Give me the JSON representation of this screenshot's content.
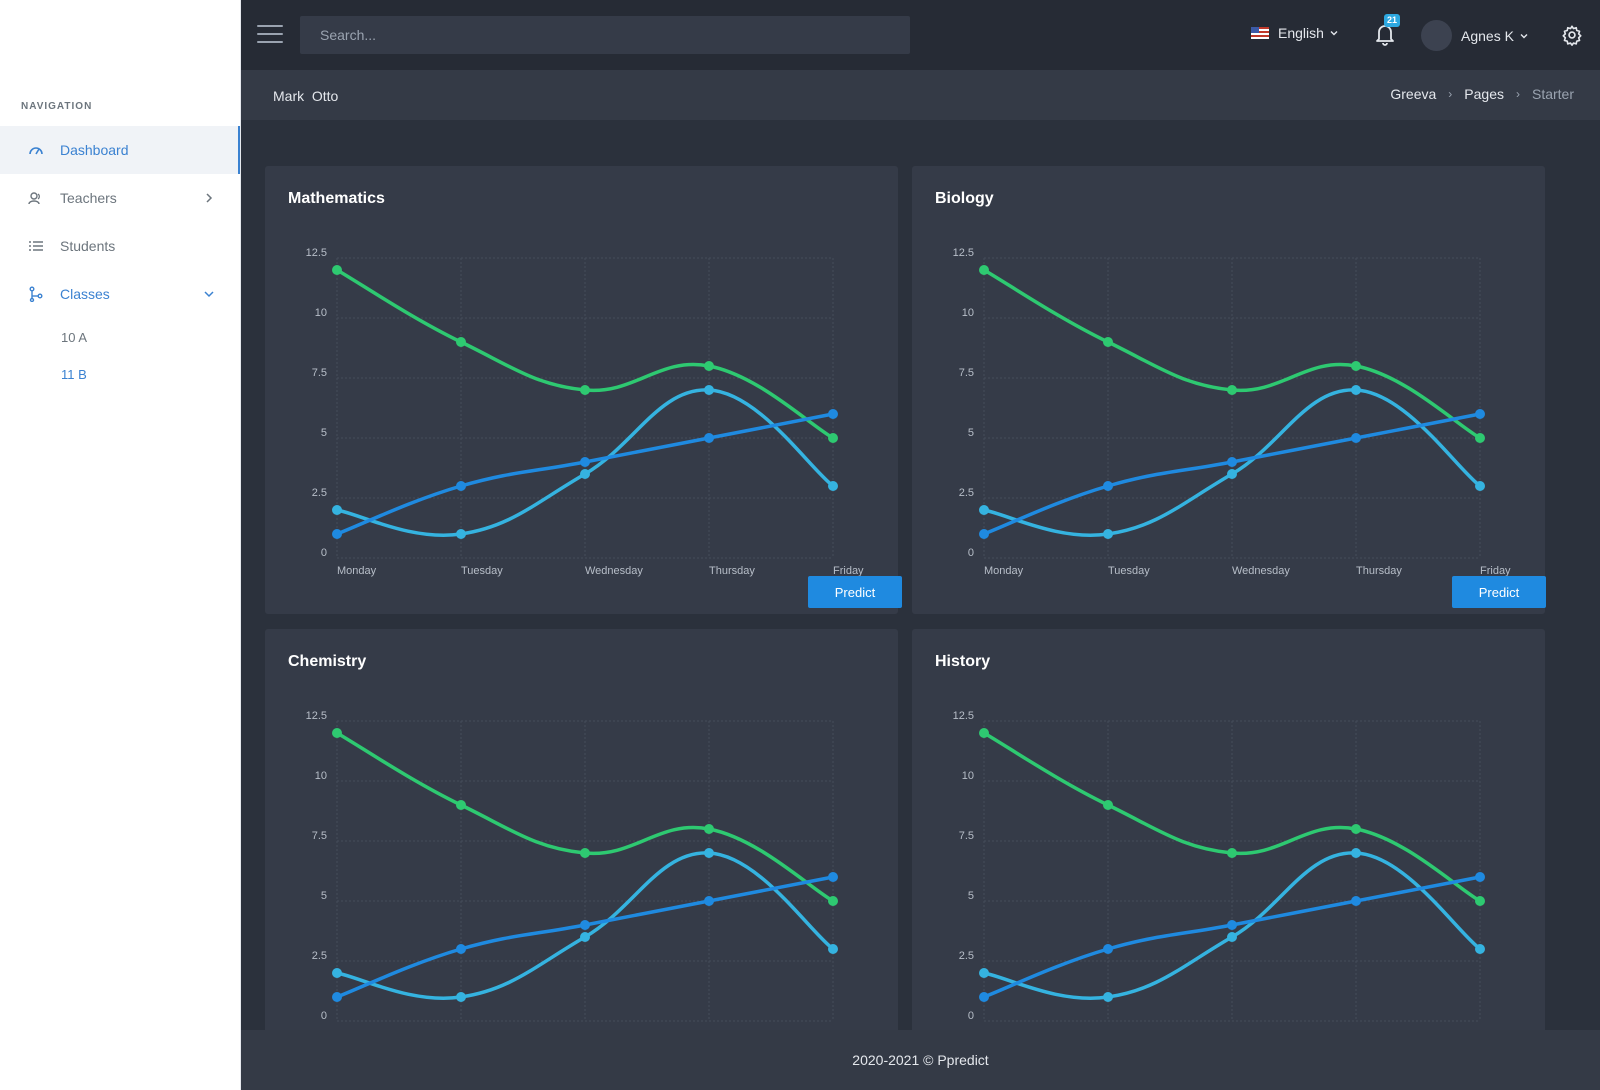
{
  "sidebar": {
    "heading": "NAVIGATION",
    "items": [
      {
        "label": "Dashboard"
      },
      {
        "label": "Teachers"
      },
      {
        "label": "Students"
      },
      {
        "label": "Classes"
      }
    ],
    "sub_items": [
      {
        "label": "10 A"
      },
      {
        "label": "11 B"
      }
    ]
  },
  "topbar": {
    "search_placeholder": "Search...",
    "language": "English",
    "notifications_count": "21",
    "user_name": "Agnes K"
  },
  "titlebar": {
    "title": "Mark  Otto",
    "breadcrumbs": [
      "Greeva",
      "Pages",
      "Starter"
    ]
  },
  "cards": [
    {
      "title": "Mathematics",
      "button": "Predict"
    },
    {
      "title": "Biology",
      "button": "Predict"
    },
    {
      "title": "Chemistry"
    },
    {
      "title": "History"
    }
  ],
  "footer": {
    "text": "2020-2021 © Ppredict"
  },
  "colors": {
    "green": "#2ec971",
    "cyan": "#35b3e0",
    "blue": "#1f8ae0"
  },
  "chart_data": {
    "type": "line",
    "categories": [
      "Monday",
      "Tuesday",
      "Wednesday",
      "Thursday",
      "Friday"
    ],
    "yticks": [
      "0",
      "2.5",
      "5",
      "7.5",
      "10",
      "12.5"
    ],
    "ylim": [
      0,
      12.5
    ],
    "grid": true,
    "series": [
      {
        "color": "#2ec971",
        "values": [
          12,
          9,
          7,
          8,
          5
        ]
      },
      {
        "color": "#35b3e0",
        "values": [
          2,
          1,
          3.5,
          7,
          3
        ]
      },
      {
        "color": "#1f8ae0",
        "values": [
          1,
          3,
          4,
          5,
          6
        ]
      }
    ]
  }
}
